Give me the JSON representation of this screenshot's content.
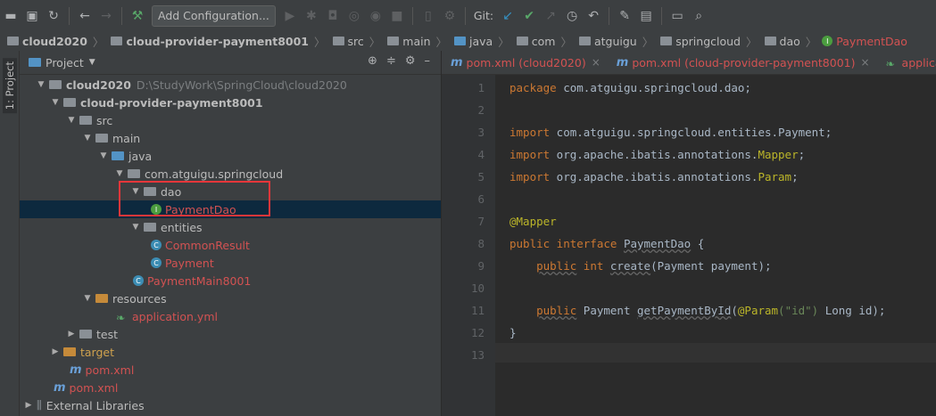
{
  "toolbar": {
    "add_config_label": "Add Configuration...",
    "git_label": "Git:"
  },
  "breadcrumb": {
    "items": [
      "cloud2020",
      "cloud-provider-payment8001",
      "src",
      "main",
      "java",
      "com",
      "atguigu",
      "springcloud",
      "dao",
      "PaymentDao"
    ]
  },
  "sidebar_tab": {
    "label": "1: Project"
  },
  "project_panel": {
    "title": "Project",
    "tree": [
      {
        "label": "cloud2020",
        "path": "D:\\StudyWork\\SpringCloud\\cloud2020"
      },
      {
        "label": "cloud-provider-payment8001"
      },
      {
        "label": "src"
      },
      {
        "label": "main"
      },
      {
        "label": "java"
      },
      {
        "label": "com.atguigu.springcloud"
      },
      {
        "label": "dao"
      },
      {
        "label": "PaymentDao"
      },
      {
        "label": "entities"
      },
      {
        "label": "CommonResult"
      },
      {
        "label": "Payment"
      },
      {
        "label": "PaymentMain8001"
      },
      {
        "label": "resources"
      },
      {
        "label": "application.yml"
      },
      {
        "label": "test"
      },
      {
        "label": "target"
      },
      {
        "label": "pom.xml"
      },
      {
        "label": "pom.xml"
      },
      {
        "label": "External Libraries"
      }
    ]
  },
  "editor": {
    "tabs": [
      {
        "label": "pom.xml (cloud2020)"
      },
      {
        "label": "pom.xml (cloud-provider-payment8001)"
      },
      {
        "label": "application.y"
      }
    ],
    "line_numbers": [
      "1",
      "2",
      "3",
      "4",
      "5",
      "6",
      "7",
      "8",
      "9",
      "10",
      "11",
      "12",
      "13"
    ],
    "code": {
      "l1_kw": "package",
      "l1_rest": " com.atguigu.springcloud.dao;",
      "l3_kw": "import",
      "l3_rest": " com.atguigu.springcloud.entities.Payment;",
      "l4_kw": "import",
      "l4_pkg": " org.apache.ibatis.annotations.",
      "l4_cls": "Mapper",
      "l4_end": ";",
      "l5_kw": "import",
      "l5_pkg": " org.apache.ibatis.annotations.",
      "l5_cls": "Param",
      "l5_end": ";",
      "l7_an": "@Mapper",
      "l8_kw": "public interface",
      "l8_name": "PaymentDao",
      "l8_end": " {",
      "l9_kw1": "public",
      "l9_kw2": " int",
      "l9_fn": "create",
      "l9_rest": "(Payment payment);",
      "l11_kw": "public",
      "l11_type": " Payment ",
      "l11_fn": "getPaymentById",
      "l11_open": "(",
      "l11_an": "@Param",
      "l11_str": "(\"id\")",
      "l11_rest": " Long id);",
      "l12": "}"
    }
  }
}
